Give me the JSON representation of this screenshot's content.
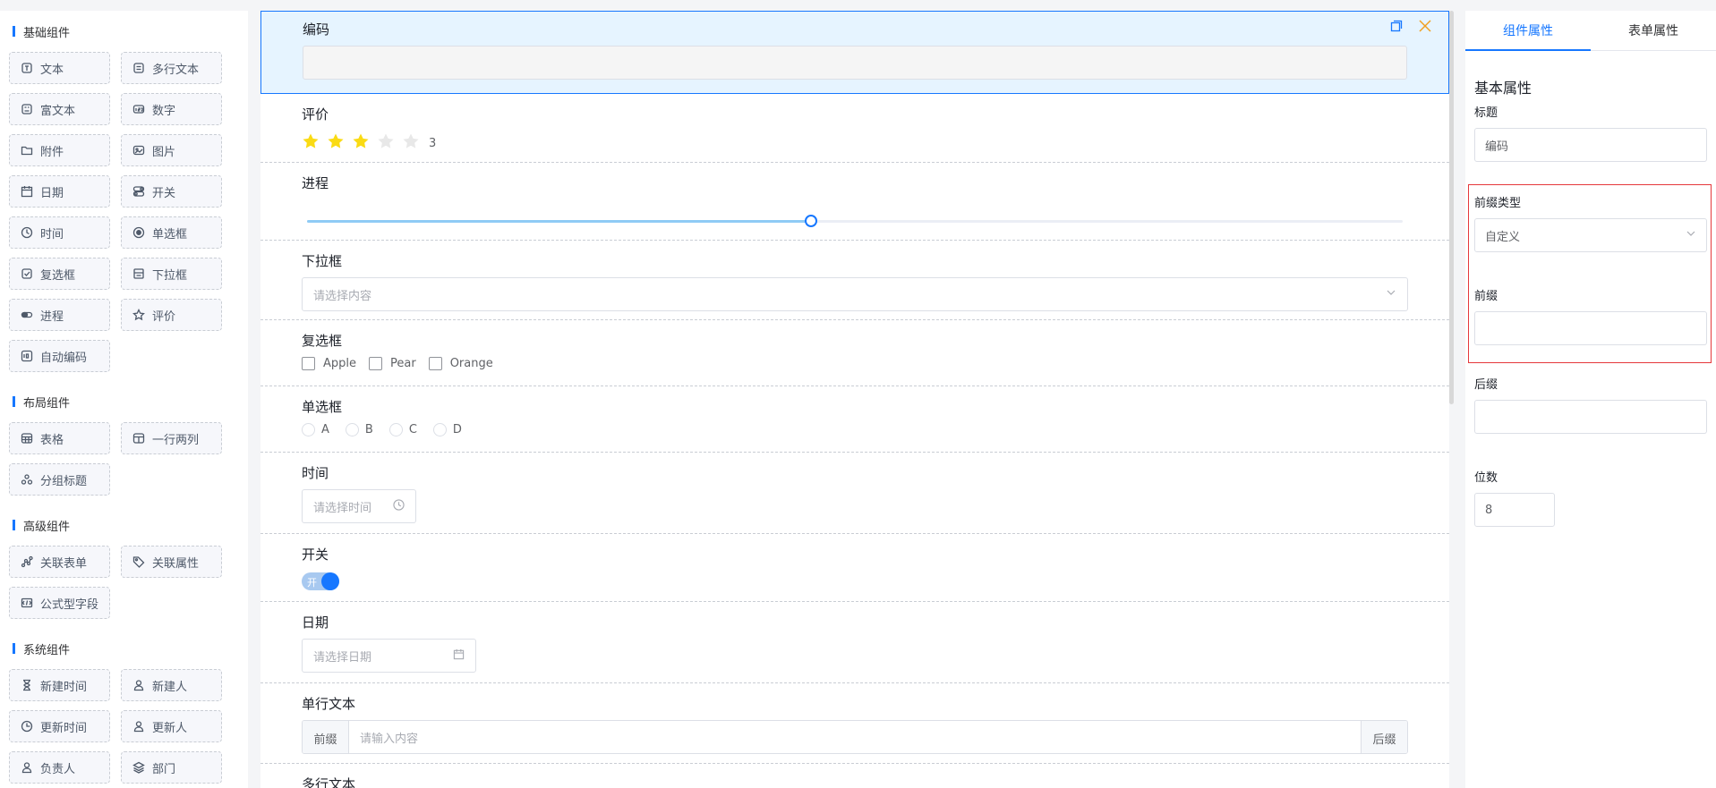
{
  "left_panel": {
    "groups": [
      {
        "title": "基础组件",
        "items": [
          {
            "label": "文本",
            "icon": "text-icon"
          },
          {
            "label": "多行文本",
            "icon": "multiline-text-icon"
          },
          {
            "label": "富文本",
            "icon": "rich-text-icon"
          },
          {
            "label": "数字",
            "icon": "number-icon"
          },
          {
            "label": "附件",
            "icon": "folder-icon"
          },
          {
            "label": "图片",
            "icon": "image-icon"
          },
          {
            "label": "日期",
            "icon": "calendar-icon"
          },
          {
            "label": "开关",
            "icon": "switch-icon"
          },
          {
            "label": "时间",
            "icon": "clock-icon"
          },
          {
            "label": "单选框",
            "icon": "radio-icon"
          },
          {
            "label": "复选框",
            "icon": "checkbox-icon"
          },
          {
            "label": "下拉框",
            "icon": "dropdown-icon"
          },
          {
            "label": "进程",
            "icon": "progress-icon"
          },
          {
            "label": "评价",
            "icon": "star-icon"
          },
          {
            "label": "自动编码",
            "icon": "auto-code-icon"
          }
        ]
      },
      {
        "title": "布局组件",
        "items": [
          {
            "label": "表格",
            "icon": "table-icon"
          },
          {
            "label": "一行两列",
            "icon": "two-column-icon"
          },
          {
            "label": "分组标题",
            "icon": "group-title-icon"
          }
        ]
      },
      {
        "title": "高级组件",
        "items": [
          {
            "label": "关联表单",
            "icon": "link-form-icon"
          },
          {
            "label": "关联属性",
            "icon": "tag-icon"
          },
          {
            "label": "公式型字段",
            "icon": "formula-icon"
          }
        ]
      },
      {
        "title": "系统组件",
        "items": [
          {
            "label": "新建时间",
            "icon": "hourglass-icon"
          },
          {
            "label": "新建人",
            "icon": "user-icon"
          },
          {
            "label": "更新时间",
            "icon": "update-time-icon"
          },
          {
            "label": "更新人",
            "icon": "user-icon"
          },
          {
            "label": "负责人",
            "icon": "user-icon"
          },
          {
            "label": "部门",
            "icon": "layers-icon"
          }
        ]
      }
    ]
  },
  "form": {
    "code": {
      "label": "编码"
    },
    "rating": {
      "label": "评价",
      "value": 3,
      "max": 5,
      "value_text": "3"
    },
    "progress": {
      "label": "进程",
      "value": 0.46
    },
    "select": {
      "label": "下拉框",
      "placeholder": "请选择内容"
    },
    "checkbox": {
      "label": "复选框",
      "options": [
        "Apple",
        "Pear",
        "Orange"
      ]
    },
    "radio": {
      "label": "单选框",
      "options": [
        "A",
        "B",
        "C",
        "D"
      ]
    },
    "time": {
      "label": "时间",
      "placeholder": "请选择时间"
    },
    "switch": {
      "label": "开关",
      "on_text": "开"
    },
    "date": {
      "label": "日期",
      "placeholder": "请选择日期"
    },
    "single_text": {
      "label": "单行文本",
      "prefix": "前缀",
      "suffix": "后缀",
      "placeholder": "请输入内容"
    },
    "multi_text": {
      "label": "多行文本"
    }
  },
  "right_panel": {
    "tabs": [
      {
        "label": "组件属性",
        "active": true
      },
      {
        "label": "表单属性",
        "active": false
      }
    ],
    "section_title": "基本属性",
    "title_label": "标题",
    "title_value": "编码",
    "prefix_type_label": "前缀类型",
    "prefix_type_value": "自定义",
    "prefix_label": "前缀",
    "prefix_value": "",
    "suffix_label": "后缀",
    "suffix_value": "",
    "digits_label": "位数",
    "digits_value": "8"
  },
  "colors": {
    "accent": "#1677ff",
    "star": "#fadb14",
    "highlight_box": "#e5383b"
  }
}
